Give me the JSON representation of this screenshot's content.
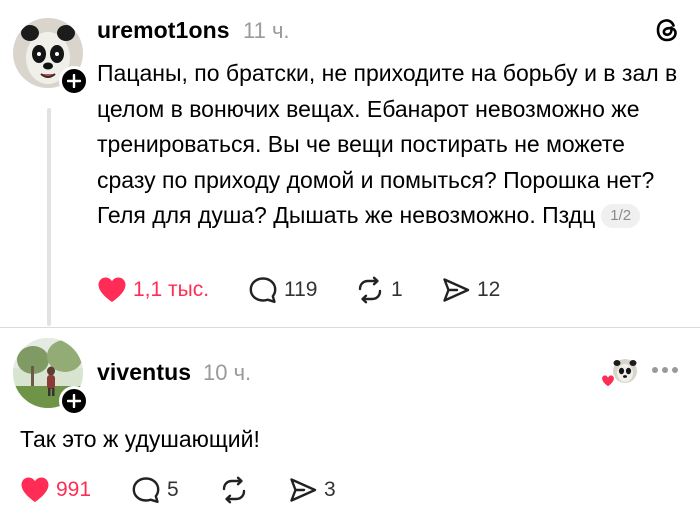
{
  "post": {
    "username": "uremot1ons",
    "time": "11 ч.",
    "text": "Пацаны, по братски, не приходите на борьбу и в зал в целом в вонючих вещах. Ебанарот невозможно же тренироваться. Вы че вещи постирать не можете сразу по приходу домой и помыться? Порошка нет? Геля для душа? Дышать же невозможно. Пздц",
    "page_indicator": "1/2",
    "actions": {
      "likes": "1,1 тыс.",
      "comments": "119",
      "reposts": "1",
      "shares": "12"
    }
  },
  "reply": {
    "username": "viventus",
    "time": "10 ч.",
    "text": "Так это ж удушающий!",
    "actions": {
      "likes": "991",
      "comments": "5",
      "reposts": "",
      "shares": "3"
    }
  },
  "colors": {
    "like_red": "#ff2d55",
    "muted_gray": "#9a9a9a",
    "text": "#000000"
  },
  "icons": [
    "threads-logo-icon",
    "heart-icon",
    "comment-icon",
    "repost-icon",
    "share-icon",
    "plus-icon",
    "more-icon"
  ]
}
